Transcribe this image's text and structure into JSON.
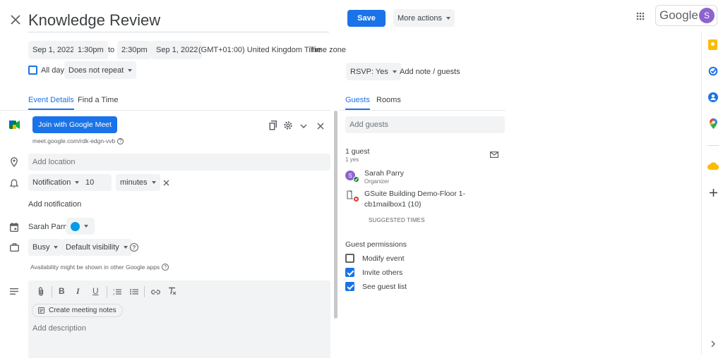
{
  "header": {
    "title": "Knowledge Review",
    "save_label": "Save",
    "more_actions_label": "More actions",
    "google_label": "Google",
    "avatar_letter": "S"
  },
  "time_row": {
    "start_date": "Sep 1, 2022",
    "start_time": "1:30pm",
    "to_label": "to",
    "end_time": "2:30pm",
    "end_date": "Sep 1, 2022",
    "timezone_text": "(GMT+01:00) United Kingdom Time",
    "timezone_link": "Time zone",
    "all_day_label": "All day",
    "all_day_checked": false,
    "repeat_label": "Does not repeat",
    "rsvp_label": "RSVP: Yes",
    "add_note_label": "Add note / guests"
  },
  "tabs": {
    "event_details": "Event Details",
    "find_time": "Find a Time",
    "guests": "Guests",
    "rooms": "Rooms"
  },
  "details": {
    "meet_button": "Join with Google Meet",
    "meet_link": "meet.google.com/rdk-edgn-vvb",
    "location_placeholder": "Add location",
    "notification_type": "Notification",
    "notification_value": "10",
    "notification_unit": "minutes",
    "add_notification": "Add notification",
    "calendar_owner": "Sarah Parry",
    "calendar_color": "#039be5",
    "busy_label": "Busy",
    "visibility_label": "Default visibility",
    "availability_note": "Availability might be shown in other Google apps",
    "create_notes_label": "Create meeting notes",
    "description_placeholder": "Add description"
  },
  "guests": {
    "add_placeholder": "Add guests",
    "count_label": "1 guest",
    "yes_label": "1 yes",
    "list": [
      {
        "name": "Sarah Parry",
        "role": "Organizer",
        "initial": "S"
      },
      {
        "name": "GSuite Building Demo-Floor 1-cb1mailbox1 (10)",
        "role": ""
      }
    ],
    "suggested_times": "SUGGESTED TIMES",
    "permissions_title": "Guest permissions",
    "permissions": [
      {
        "label": "Modify event",
        "checked": false
      },
      {
        "label": "Invite others",
        "checked": true
      },
      {
        "label": "See guest list",
        "checked": true
      }
    ]
  },
  "colors": {
    "accent": "#1a73e8",
    "avatar": "#8e63ce",
    "chip_bg": "#f1f3f4"
  }
}
